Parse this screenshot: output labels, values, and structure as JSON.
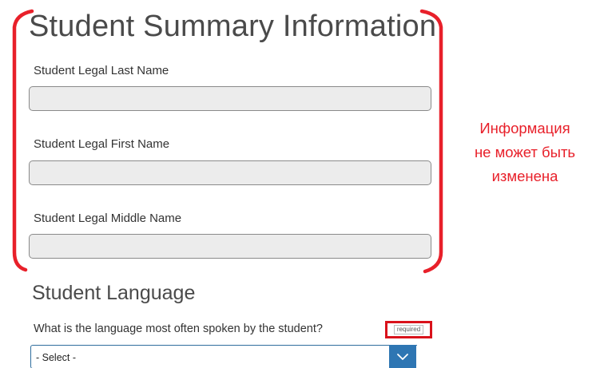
{
  "summary": {
    "title": "Student Summary Information",
    "fields": [
      {
        "label": "Student Legal Last Name",
        "value": ""
      },
      {
        "label": "Student Legal First Name",
        "value": ""
      },
      {
        "label": "Student Legal Middle Name",
        "value": ""
      }
    ]
  },
  "annotation": {
    "lines": [
      "Информация",
      "не может быть",
      "изменена"
    ],
    "color": "#e8202a"
  },
  "language": {
    "title": "Student Language",
    "question": "What is the language most often spoken by the student?",
    "required_label": "required",
    "select_value": "- Select -",
    "accent_color": "#2e76b3"
  }
}
